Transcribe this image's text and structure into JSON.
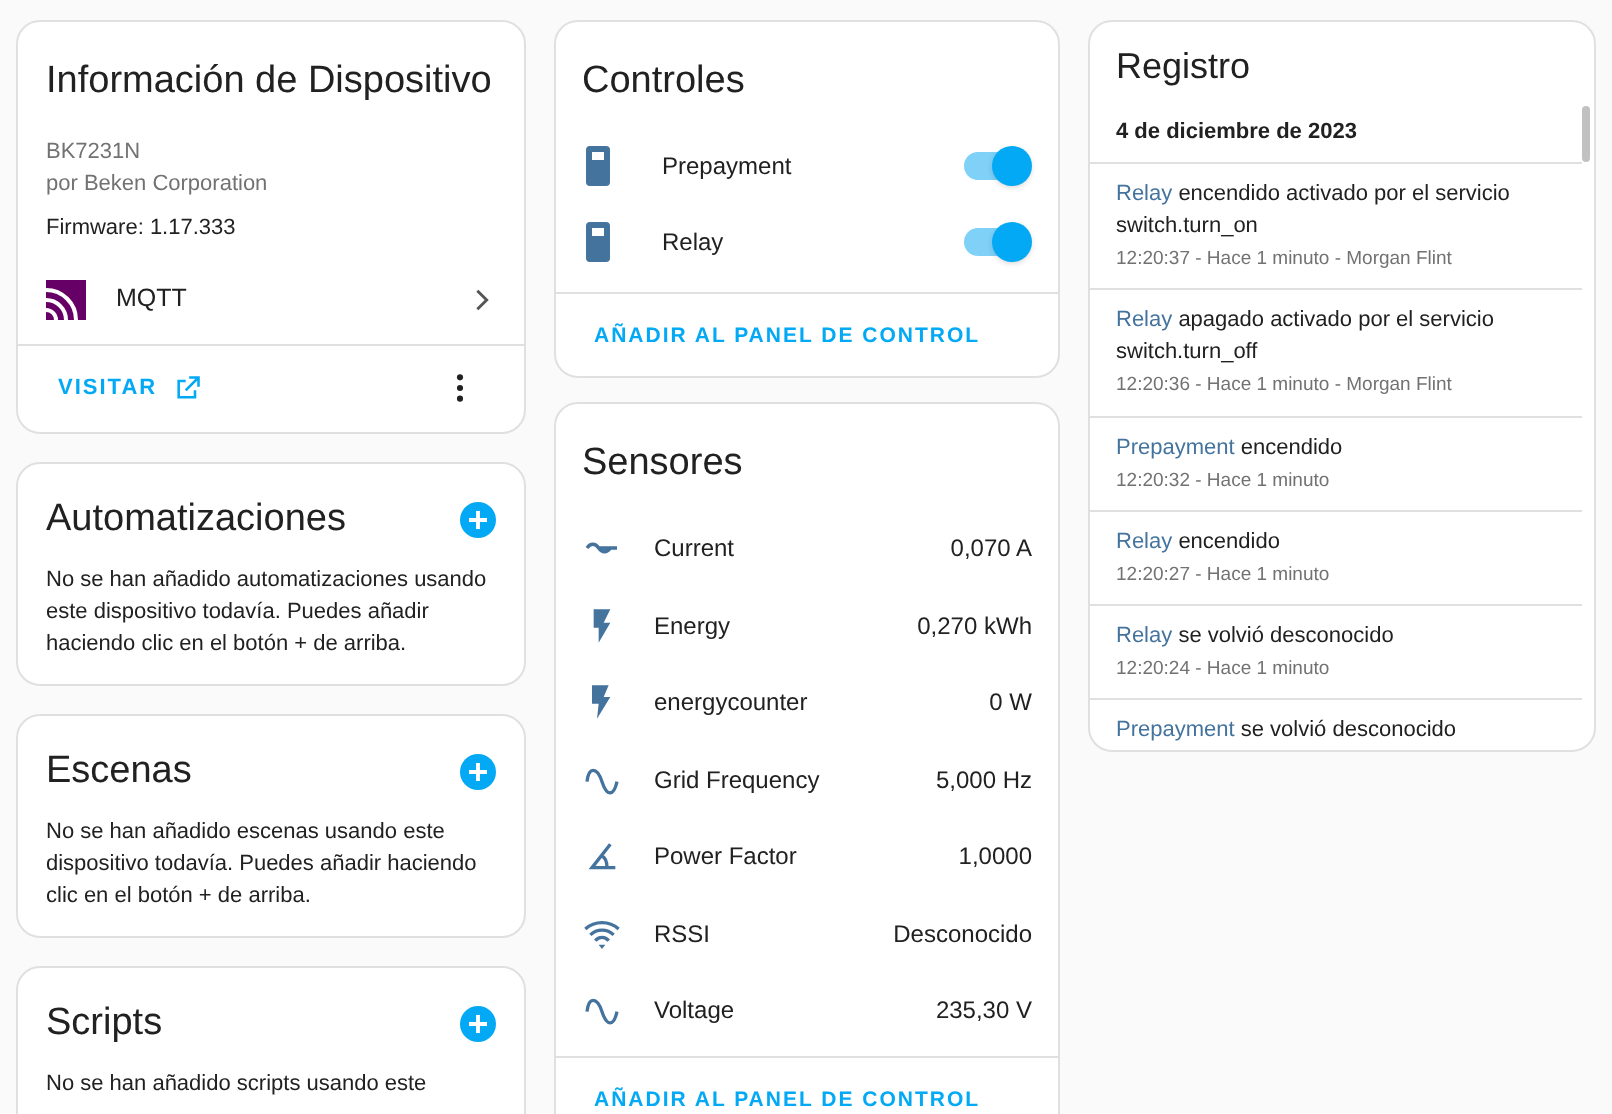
{
  "device_info": {
    "title": "Información de Dispositivo",
    "model": "BK7231N",
    "manufacturer": "por Beken Corporation",
    "firmware": "Firmware: 1.17.333",
    "integration": "MQTT",
    "visit_button": "VISITAR"
  },
  "automations": {
    "title": "Automatizaciones",
    "text": "No se han añadido automatizaciones usando este dispositivo todavía. Puedes añadir haciendo clic en el botón + de arriba."
  },
  "scenes": {
    "title": "Escenas",
    "text": "No se han añadido escenas usando este dispositivo todavía. Puedes añadir haciendo clic en el botón + de arriba."
  },
  "scripts": {
    "title": "Scripts",
    "text": "No se han añadido scripts usando este"
  },
  "controls": {
    "title": "Controles",
    "items": [
      {
        "name": "Prepayment",
        "on": true
      },
      {
        "name": "Relay",
        "on": true
      }
    ],
    "add_button": "AÑADIR AL PANEL DE CONTROL"
  },
  "sensors": {
    "title": "Sensores",
    "items": [
      {
        "kind": "current",
        "name": "Current",
        "value": "0,070 A"
      },
      {
        "kind": "bolt",
        "name": "Energy",
        "value": "0,270 kWh"
      },
      {
        "kind": "bolt2",
        "name": "energycounter",
        "value": "0 W"
      },
      {
        "kind": "sine",
        "name": "Grid Frequency",
        "value": "5,000 Hz"
      },
      {
        "kind": "angle",
        "name": "Power Factor",
        "value": "1,0000"
      },
      {
        "kind": "wifi",
        "name": "RSSI",
        "value": "Desconocido"
      },
      {
        "kind": "sine",
        "name": "Voltage",
        "value": "235,30 V"
      }
    ],
    "add_button": "AÑADIR AL PANEL DE CONTROL"
  },
  "logbook": {
    "title": "Registro",
    "date": "4 de diciembre de 2023",
    "entries": [
      {
        "entity": "Relay",
        "message": "encendido activado por el servicio switch.turn_on",
        "detail": "12:20:37 - Hace 1 minuto - Morgan Flint"
      },
      {
        "entity": "Relay",
        "message": "apagado activado por el servicio switch.turn_off",
        "detail": "12:20:36 - Hace 1 minuto - Morgan Flint"
      },
      {
        "entity": "Prepayment",
        "message": "encendido",
        "detail": "12:20:32 - Hace 1 minuto"
      },
      {
        "entity": "Relay",
        "message": "encendido",
        "detail": "12:20:27 - Hace 1 minuto"
      },
      {
        "entity": "Relay",
        "message": "se volvió desconocido",
        "detail": "12:20:24 - Hace 1 minuto"
      },
      {
        "entity": "Prepayment",
        "message": "se volvió desconocido"
      }
    ]
  }
}
